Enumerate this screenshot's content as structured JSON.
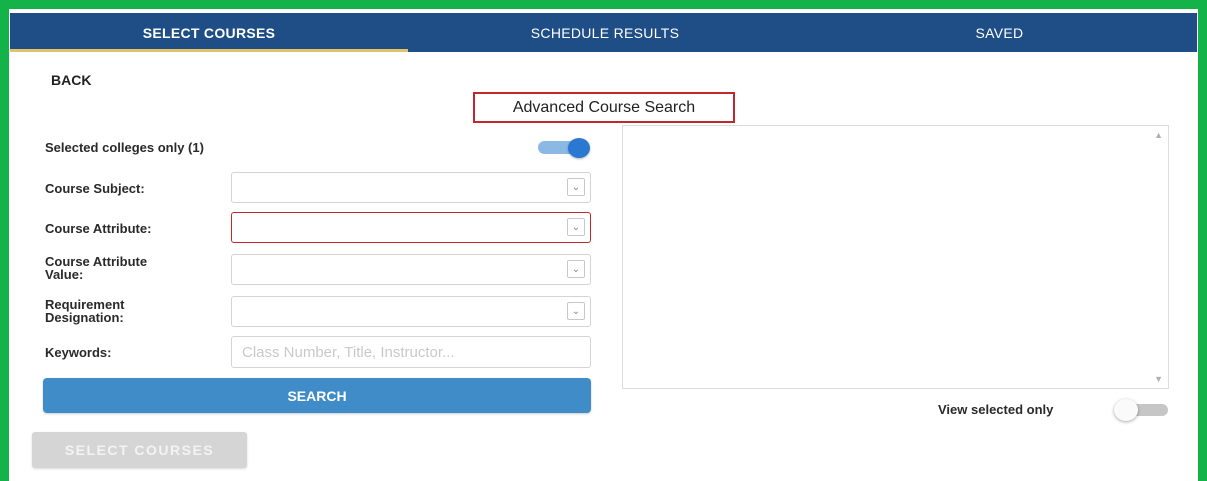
{
  "tabs": [
    {
      "label": "SELECT COURSES",
      "active": true
    },
    {
      "label": "SCHEDULE RESULTS",
      "active": false
    },
    {
      "label": "SAVED",
      "active": false
    }
  ],
  "back_label": "BACK",
  "advanced_title": "Advanced Course Search",
  "form": {
    "selected_colleges_label": "Selected colleges only (1)",
    "selected_colleges_toggle": true,
    "course_subject_label": "Course Subject:",
    "course_subject_value": "",
    "course_attribute_label": "Course Attribute:",
    "course_attribute_value": "",
    "course_attribute_value_label_line1": "Course Attribute",
    "course_attribute_value_label_line2": "Value:",
    "course_attribute_value_value": "",
    "requirement_label_line1": "Requirement",
    "requirement_label_line2": "Designation:",
    "requirement_value": "",
    "keywords_label": "Keywords:",
    "keywords_placeholder": "Class Number, Title, Instructor...",
    "keywords_value": "",
    "search_label": "SEARCH"
  },
  "results": {
    "view_selected_label": "View selected only",
    "view_selected_toggle": false
  },
  "select_courses_button": "SELECT COURSES",
  "colors": {
    "border_green": "#13b34a",
    "nav_blue": "#1f4e86",
    "tab_underline": "#e2c26a",
    "highlight_red": "#c0282e",
    "search_blue": "#3f8cc9",
    "toggle_on": "#2b78d2"
  },
  "icons": {
    "dropdown": "chevron-down-icon",
    "scroll_up": "scroll-up-icon",
    "scroll_down": "scroll-down-icon"
  }
}
